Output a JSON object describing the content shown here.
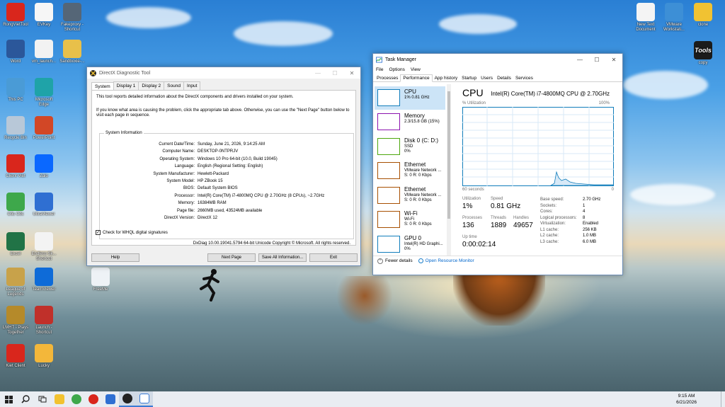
{
  "desktop": {
    "left_icons": [
      {
        "label": "RongVietTool",
        "color": "#d9261c"
      },
      {
        "label": "EVKey",
        "color": "#f6f6f6"
      },
      {
        "label": "Fakeproxy - Shortcut",
        "color": "#556677"
      },
      {
        "label": "Word",
        "color": "#2b579a"
      },
      {
        "label": "vm_launch...",
        "color": "#f2f2f2"
      },
      {
        "label": "Sandboxie-...",
        "color": "#e8c04a"
      },
      {
        "label": "This PC",
        "color": "#4a9bd6"
      },
      {
        "label": "Microsoft Edge",
        "color": "#1fa3a8"
      },
      {
        "label": "Recycle Bin",
        "color": "#b8c8d8"
      },
      {
        "label": "PowerPoint",
        "color": "#d24726"
      },
      {
        "label": "Client Viet",
        "color": "#d9261c"
      },
      {
        "label": "Zalo",
        "color": "#0a68ff"
      },
      {
        "label": "Cốc Cốc",
        "color": "#3ea84b"
      },
      {
        "label": "UltraViewer",
        "color": "#2f6fd2"
      },
      {
        "label": "Excel",
        "color": "#217346"
      },
      {
        "label": "Endless Sk... Shortcut",
        "color": "#f3f3f3"
      },
      {
        "label": "League of Legends",
        "color": "#c8a24a"
      },
      {
        "label": "TeamViewer",
        "color": "#0e6bd8"
      },
      {
        "label": "FreeMe",
        "color": "#eef2f6"
      },
      {
        "label": "LMHT - Plays Together",
        "color": "#b58a2a"
      },
      {
        "label": "Launch - Shortcut",
        "color": "#c0302a"
      },
      {
        "label": "Kiet Client",
        "color": "#d9261c"
      },
      {
        "label": "Lucky",
        "color": "#f3b73a"
      }
    ],
    "right_icons": [
      {
        "label": "New Text Document",
        "color": "#f4f4f4"
      },
      {
        "label": "VMware Workstati...",
        "color": "#3d8fd6"
      },
      {
        "label": "clone",
        "color": "#f1c232"
      },
      {
        "label": "copy",
        "color": "#1b1b1b",
        "glyph": "Tools"
      }
    ]
  },
  "directx": {
    "title": "DirectX Diagnostic Tool",
    "tabs": [
      "System",
      "Display 1",
      "Display 2",
      "Sound",
      "Input"
    ],
    "intro1": "This tool reports detailed information about the DirectX components and drivers installed on your system.",
    "intro2": "If you know what area is causing the problem, click the appropriate tab above.  Otherwise, you can use the \"Next Page\" button below to visit each page in sequence.",
    "section_title": "System Information",
    "rows": [
      {
        "k": "Current Date/Time:",
        "v": "Sunday, June 21, 2026, 9:14:25 AM"
      },
      {
        "k": "Computer Name:",
        "v": "DESKTOP-0NTPRJV"
      },
      {
        "k": "Operating System:",
        "v": "Windows 10 Pro 64-bit (10.0, Build 19045)"
      },
      {
        "k": "Language:",
        "v": "English (Regional Setting: English)"
      },
      {
        "k": "System Manufacturer:",
        "v": "Hewlett-Packard"
      },
      {
        "k": "System Model:",
        "v": "HP ZBook 15"
      },
      {
        "k": "BIOS:",
        "v": "Default System BIOS"
      },
      {
        "k": "Processor:",
        "v": "Intel(R) Core(TM) i7-4800MQ CPU @ 2.70GHz (8 CPUs), ~2.7GHz"
      },
      {
        "k": "Memory:",
        "v": "16384MB RAM"
      },
      {
        "k": "Page file:",
        "v": "2660MB used, 43524MB available"
      },
      {
        "k": "DirectX Version:",
        "v": "DirectX 12"
      }
    ],
    "whql_label": "Check for WHQL digital signatures",
    "whql_checked": "✓",
    "copyright": "DxDiag 10.00.19041.5794 64-bit Unicode  Copyright © Microsoft. All rights reserved.",
    "btn_help": "Help",
    "btn_next": "Next Page",
    "btn_save": "Save All Information...",
    "btn_exit": "Exit"
  },
  "taskmgr": {
    "title": "Task Manager",
    "menu": [
      "File",
      "Options",
      "View"
    ],
    "tabs": [
      "Processes",
      "Performance",
      "App history",
      "Startup",
      "Users",
      "Details",
      "Services"
    ],
    "side": [
      {
        "name": "CPU",
        "l1": "1% 0.81 GHz",
        "l2": "",
        "color": "#117dbb"
      },
      {
        "name": "Memory",
        "l1": "2.3/15.8 GB (15%)",
        "l2": "",
        "color": "#8b12ae"
      },
      {
        "name": "Disk 0 (C: D:)",
        "l1": "SSD",
        "l2": "0%",
        "color": "#4da60c"
      },
      {
        "name": "Ethernet",
        "l1": "VMware Network ...",
        "l2": "S: 0 R: 0 Kbps",
        "color": "#a74f01"
      },
      {
        "name": "Ethernet",
        "l1": "VMware Network ...",
        "l2": "S: 0 R: 0 Kbps",
        "color": "#a74f01"
      },
      {
        "name": "Wi-Fi",
        "l1": "Wi-Fi",
        "l2": "S: 0 R: 0 Kbps",
        "color": "#a74f01"
      },
      {
        "name": "GPU 0",
        "l1": "Intel(R) HD Graphi...",
        "l2": "0%",
        "color": "#117dbb"
      }
    ],
    "cpu_title": "CPU",
    "cpu_name": "Intel(R) Core(TM) i7-4800MQ CPU @ 2.70GHz",
    "util_label": "% Utilization",
    "util_max": "100%",
    "graph_time": "60 seconds",
    "graph_zero": "0",
    "stats": {
      "utilization_label": "Utilization",
      "utilization": "1%",
      "speed_label": "Speed",
      "speed": "0.81 GHz",
      "processes_label": "Processes",
      "processes": "136",
      "threads_label": "Threads",
      "threads": "1889",
      "handles_label": "Handles",
      "handles": "49657",
      "uptime_label": "Up time",
      "uptime": "0:00:02:14"
    },
    "specs": [
      {
        "k": "Base speed:",
        "v": "2.70 GHz"
      },
      {
        "k": "Sockets:",
        "v": "1"
      },
      {
        "k": "Cores:",
        "v": "4"
      },
      {
        "k": "Logical processors:",
        "v": "8"
      },
      {
        "k": "Virtualization:",
        "v": "Enabled"
      },
      {
        "k": "L1 cache:",
        "v": "256 KB"
      },
      {
        "k": "L2 cache:",
        "v": "1.0 MB"
      },
      {
        "k": "L3 cache:",
        "v": "6.0 MB"
      }
    ],
    "fewer": "Fewer details",
    "open_rm": "Open Resource Monitor"
  },
  "taskbar": {
    "time": "9:15 AM",
    "date": "6/21/2026"
  }
}
